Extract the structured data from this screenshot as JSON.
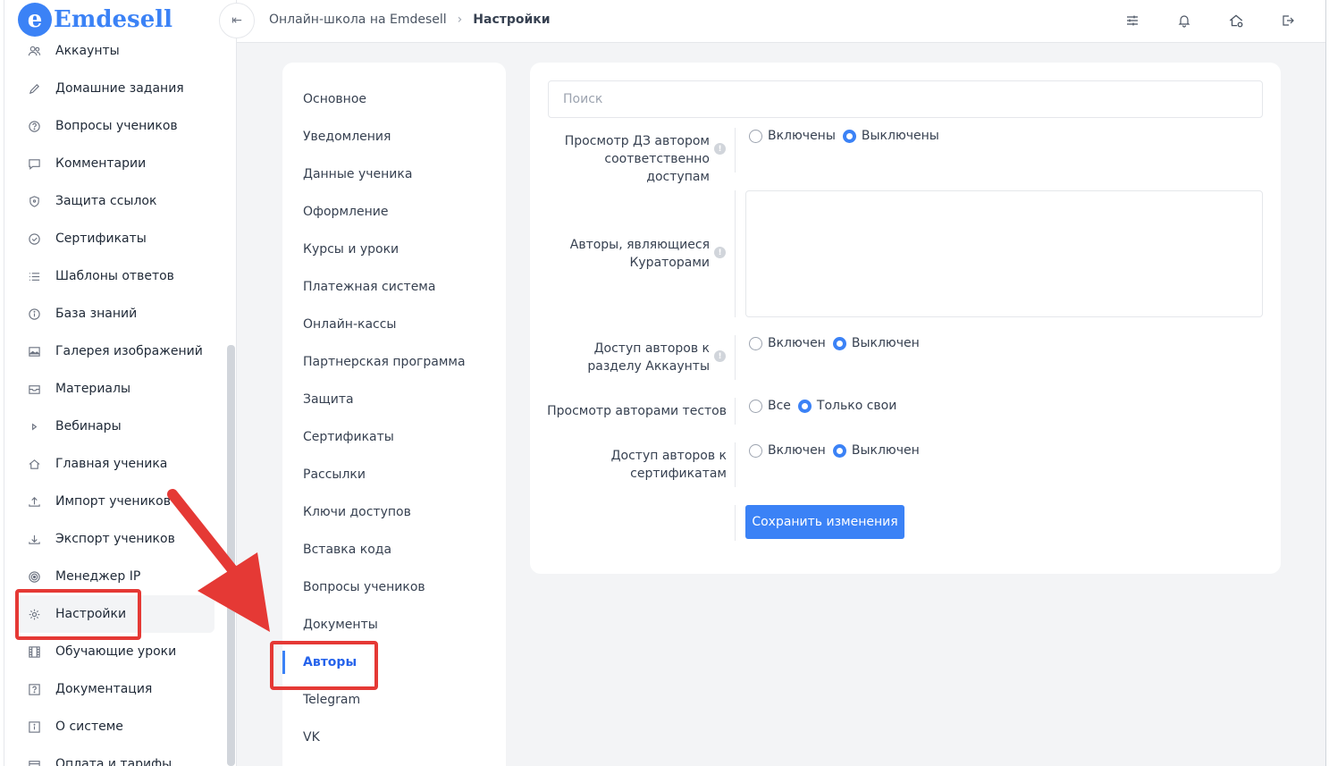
{
  "brand": {
    "badge": "e",
    "name": "Emdesell"
  },
  "sidebar": {
    "items": [
      {
        "label": "Аккаунты",
        "icon": "users-icon"
      },
      {
        "label": "Домашние задания",
        "icon": "pencil-icon"
      },
      {
        "label": "Вопросы учеников",
        "icon": "question-circle-icon"
      },
      {
        "label": "Комментарии",
        "icon": "comment-icon"
      },
      {
        "label": "Защита ссылок",
        "icon": "shield-icon"
      },
      {
        "label": "Сертификаты",
        "icon": "check-circle-icon"
      },
      {
        "label": "Шаблоны ответов",
        "icon": "list-icon"
      },
      {
        "label": "База знаний",
        "icon": "info-circle-icon"
      },
      {
        "label": "Галерея изображений",
        "icon": "image-icon"
      },
      {
        "label": "Материалы",
        "icon": "inbox-icon"
      },
      {
        "label": "Вебинары",
        "icon": "play-icon"
      },
      {
        "label": "Главная ученика",
        "icon": "home-icon"
      },
      {
        "label": "Импорт учеников",
        "icon": "upload-icon"
      },
      {
        "label": "Экспорт учеников",
        "icon": "download-icon"
      },
      {
        "label": "Менеджер IP",
        "icon": "target-icon"
      },
      {
        "label": "Настройки",
        "icon": "gear-icon"
      },
      {
        "label": "Обучающие уроки",
        "icon": "film-icon"
      },
      {
        "label": "Документация",
        "icon": "help-box-icon"
      },
      {
        "label": "О системе",
        "icon": "info-box-icon"
      },
      {
        "label": "Оплата и тарифы",
        "icon": "card-icon"
      }
    ]
  },
  "header": {
    "collapse_glyph": "⇤",
    "breadcrumb": {
      "parent": "Онлайн-школа на Emdesell",
      "separator": "›",
      "current": "Настройки"
    },
    "icons": [
      "sliders-icon",
      "bell-icon",
      "home-settings-icon",
      "logout-icon"
    ]
  },
  "settings_menu": {
    "items": [
      "Основное",
      "Уведомления",
      "Данные ученика",
      "Оформление",
      "Курсы и уроки",
      "Платежная система",
      "Онлайн-кассы",
      "Партнерская программа",
      "Защита",
      "Сертификаты",
      "Рассылки",
      "Ключи доступов",
      "Вставка кода",
      "Вопросы учеников",
      "Документы",
      "Авторы",
      "Telegram",
      "VK"
    ],
    "active": "Авторы"
  },
  "form": {
    "search_placeholder": "Поиск",
    "info_glyph": "!",
    "rows": [
      {
        "label_line1": "Просмотр ДЗ автором",
        "label_line2": "соответственно доступам",
        "options": [
          "Включены",
          "Выключены"
        ],
        "selected": 1
      },
      {
        "label_line1": "Авторы, являющиеся",
        "label_line2": "Кураторами"
      },
      {
        "label_line1": "Доступ авторов к",
        "label_line2": "разделу Аккаунты",
        "options": [
          "Включен",
          "Выключен"
        ],
        "selected": 1
      },
      {
        "label_line1": "Просмотр авторами тестов",
        "options": [
          "Все",
          "Только свои"
        ],
        "selected": 1
      },
      {
        "label_line1": "Доступ авторов к",
        "label_line2": "сертификатам",
        "options": [
          "Включен",
          "Выключен"
        ],
        "selected": 1
      }
    ],
    "save_label": "Сохранить изменения"
  },
  "colors": {
    "accent": "#3b82f6",
    "annotation": "#e53935"
  }
}
